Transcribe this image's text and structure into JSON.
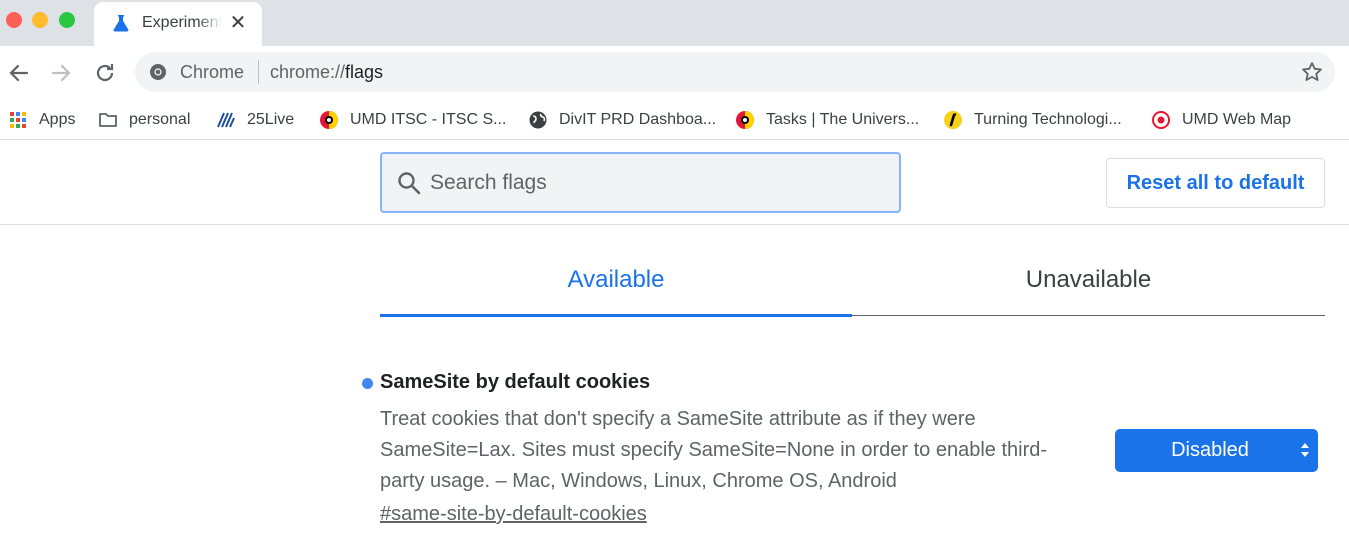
{
  "browser": {
    "tab": {
      "title": "Experiments",
      "icon": "flask-icon"
    },
    "toolbar": {
      "omnibox_scheme_label": "Chrome",
      "omnibox_url_prefix": "chrome://",
      "omnibox_url_host": "flags"
    },
    "bookmarks": [
      {
        "label": "Apps",
        "icon": "apps-grid-icon"
      },
      {
        "label": "personal",
        "icon": "folder-icon"
      },
      {
        "label": "25Live",
        "icon": "25live-icon"
      },
      {
        "label": "UMD ITSC - ITSC S...",
        "icon": "umd-logo-icon"
      },
      {
        "label": "DivIT PRD Dashboa...",
        "icon": "globe-icon"
      },
      {
        "label": "Tasks | The Univers...",
        "icon": "umd-logo-icon"
      },
      {
        "label": "Turning Technologi...",
        "icon": "turning-logo-icon"
      },
      {
        "label": "UMD Web Map",
        "icon": "umd-map-icon"
      }
    ]
  },
  "flags": {
    "search": {
      "placeholder": "Search flags"
    },
    "reset_label": "Reset all to default",
    "tabs": [
      {
        "label": "Available",
        "selected": true
      },
      {
        "label": "Unavailable",
        "selected": false
      }
    ],
    "experiment": {
      "title": "SameSite by default cookies",
      "description": "Treat cookies that don't specify a SameSite attribute as if they were SameSite=Lax. Sites must specify SameSite=None in order to enable third-party usage. – Mac, Windows, Linux, Chrome OS, Android",
      "link": "#same-site-by-default-cookies",
      "selected_value": "Disabled"
    }
  },
  "colors": {
    "accent": "#1a73e8",
    "modified_dot": "#4285f4",
    "tabstrip": "#dee1e6"
  }
}
